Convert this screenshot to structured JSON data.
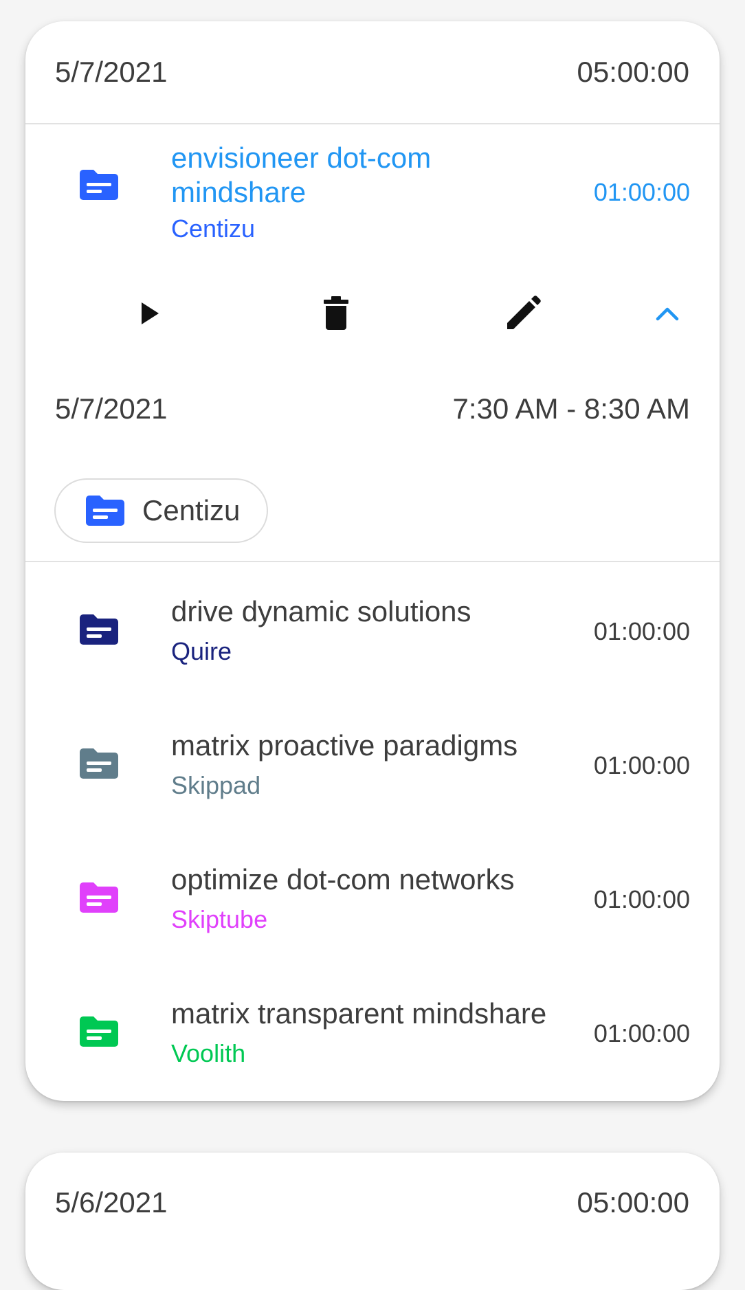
{
  "day1": {
    "date": "5/7/2021",
    "total": "05:00:00",
    "expanded_entry": {
      "title": "envisioneer dot-com mindshare",
      "client": "Centizu",
      "duration": "01:00:00",
      "accent_color": "#2196f3",
      "client_color": "#2962ff",
      "folder_color": "#2962ff",
      "actions": [
        {
          "name": "play",
          "icon": "play-icon"
        },
        {
          "name": "delete",
          "icon": "trash-icon"
        },
        {
          "name": "edit",
          "icon": "pencil-icon"
        },
        {
          "name": "collapse",
          "icon": "chevron-up-icon"
        }
      ],
      "detail_date": "5/7/2021",
      "detail_time": "7:30 AM - 8:30 AM",
      "chip_label": "Centizu"
    },
    "entries": [
      {
        "title": "drive dynamic solutions",
        "client": "Quire",
        "duration": "01:00:00",
        "color": "#1a237e"
      },
      {
        "title": "matrix proactive paradigms",
        "client": "Skippad",
        "duration": "01:00:00",
        "color": "#607d8b"
      },
      {
        "title": "optimize dot-com networks",
        "client": "Skiptube",
        "duration": "01:00:00",
        "color": "#e040fb"
      },
      {
        "title": "matrix transparent mindshare",
        "client": "Voolith",
        "duration": "01:00:00",
        "color": "#00c853"
      }
    ]
  },
  "day2": {
    "date": "5/6/2021",
    "total": "05:00:00"
  }
}
